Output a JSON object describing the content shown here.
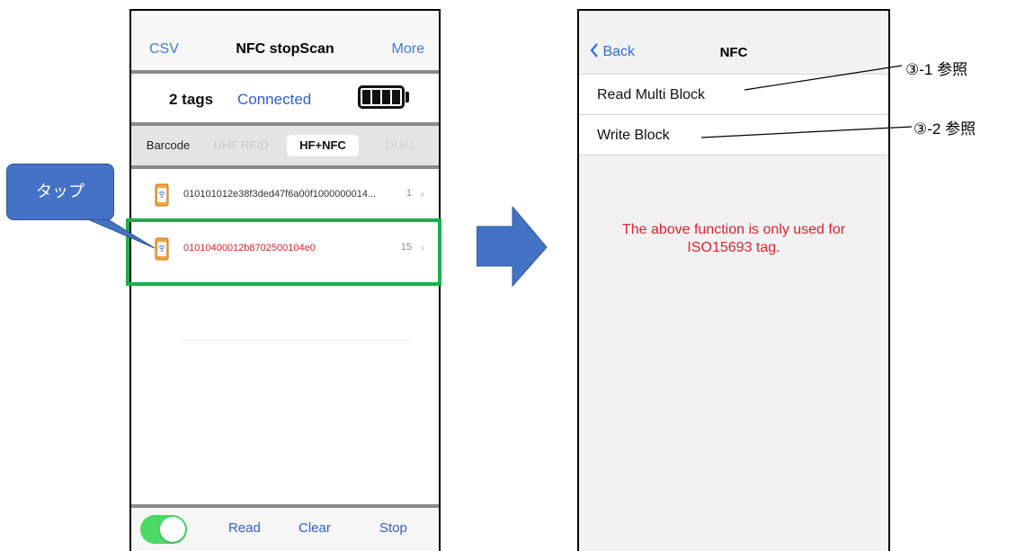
{
  "left_screen": {
    "nav": {
      "left": "CSV",
      "title": "NFC  stopScan",
      "right": "More"
    },
    "status": {
      "tag_count": "2 tags",
      "connection": "Connected"
    },
    "segments": [
      "Barcode",
      "UHF RFID",
      "HF+NFC",
      "DUAL"
    ],
    "selected_segment": "HF+NFC",
    "tags": [
      {
        "id": "010101012e38f3ded47f6a00f1000000014...",
        "count": "1",
        "color": "#333333"
      },
      {
        "id": "01010400012b8702500104e0",
        "count": "15",
        "color": "#e0212e"
      }
    ],
    "toolbar": {
      "read": "Read",
      "clear": "Clear",
      "stop": "Stop",
      "toggle_on": true
    }
  },
  "callout": {
    "text": "タップ",
    "color": "#4472c4"
  },
  "highlight_color": "#14b14a",
  "right_screen": {
    "nav": {
      "back": "Back",
      "title": "NFC"
    },
    "items": [
      "Read Multi Block",
      "Write Block"
    ],
    "note_line1": "The above function is only used for",
    "note_line2": "ISO15693 tag."
  },
  "references": {
    "ref1": "③-1 参照",
    "ref2": "③-2 参照"
  },
  "arrow_color": "#4472c4"
}
